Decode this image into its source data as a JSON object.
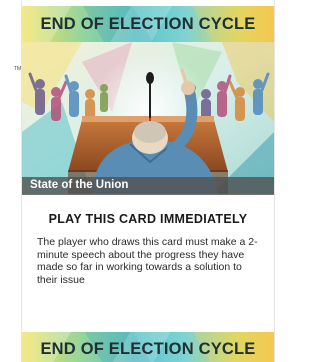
{
  "card": {
    "trademark": "TM",
    "header_title": "END OF ELECTION CYCLE",
    "caption": "State of the Union",
    "instruction": "PLAY THIS CARD IMMEDIATELY",
    "body": "The player who draws this card must make a 2-minute speech about the progress they have made so far in working towards a solution to their issue",
    "footer_title": "END OF ELECTION CYCLE"
  },
  "colors": {
    "band_gradient": [
      "#f0e25a",
      "#9bd69a",
      "#5cc3c8",
      "#7fd3d2",
      "#d6d866",
      "#f1c44a"
    ],
    "caption_bar": "#505050",
    "title_text": "#1f2f34"
  }
}
